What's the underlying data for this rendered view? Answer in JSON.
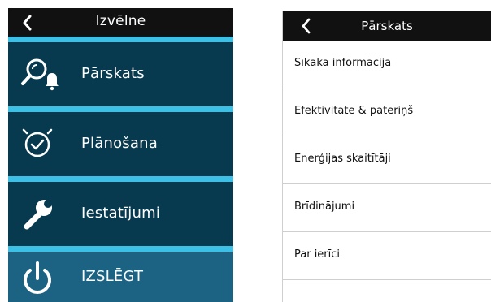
{
  "left_panel": {
    "title": "Izvēlne",
    "items": [
      {
        "label": "Pārskats",
        "icon": "overview-search-bell-icon"
      },
      {
        "label": "Plānošana",
        "icon": "clock-check-icon"
      },
      {
        "label": "Iestatījumi",
        "icon": "wrench-icon"
      },
      {
        "label": "IZSLĒGT",
        "icon": "power-icon"
      }
    ]
  },
  "right_panel": {
    "title": "Pārskats",
    "items": [
      {
        "label": "Sīkāka informācija"
      },
      {
        "label": "Efektivitāte & patēriņš"
      },
      {
        "label": "Enerģijas skaitītāji"
      },
      {
        "label": "Brīdinājumi"
      },
      {
        "label": "Par ierīci"
      }
    ]
  },
  "colors": {
    "header": "#111111",
    "accent_divider": "#3cc0e6",
    "menu_item": "#073a4f",
    "power_item": "#1b6283",
    "text_light": "#ffffff",
    "text_dark": "#111111",
    "row_border": "#cfcfcf"
  }
}
